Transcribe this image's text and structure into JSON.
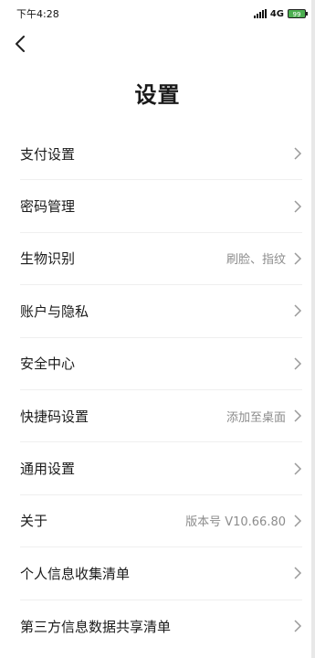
{
  "status": {
    "time": "下午4:28",
    "network": "4G",
    "battery": "99"
  },
  "header": {
    "title": "设置"
  },
  "icons": {
    "back": "chevron-left-icon",
    "row_arrow": "chevron-right-icon",
    "signal": "signal-icon",
    "battery": "battery-icon"
  },
  "colors": {
    "battery": "#4caf50",
    "secondary_text": "#8c8c8c"
  },
  "settings": {
    "items": [
      {
        "label": "支付设置",
        "value": ""
      },
      {
        "label": "密码管理",
        "value": ""
      },
      {
        "label": "生物识别",
        "value": "刷脸、指纹"
      },
      {
        "label": "账户与隐私",
        "value": ""
      },
      {
        "label": "安全中心",
        "value": ""
      },
      {
        "label": "快捷码设置",
        "value": "添加至桌面"
      },
      {
        "label": "通用设置",
        "value": ""
      },
      {
        "label": "关于",
        "value": "版本号 V10.66.80"
      },
      {
        "label": "个人信息收集清单",
        "value": ""
      },
      {
        "label": "第三方信息数据共享清单",
        "value": ""
      }
    ]
  }
}
